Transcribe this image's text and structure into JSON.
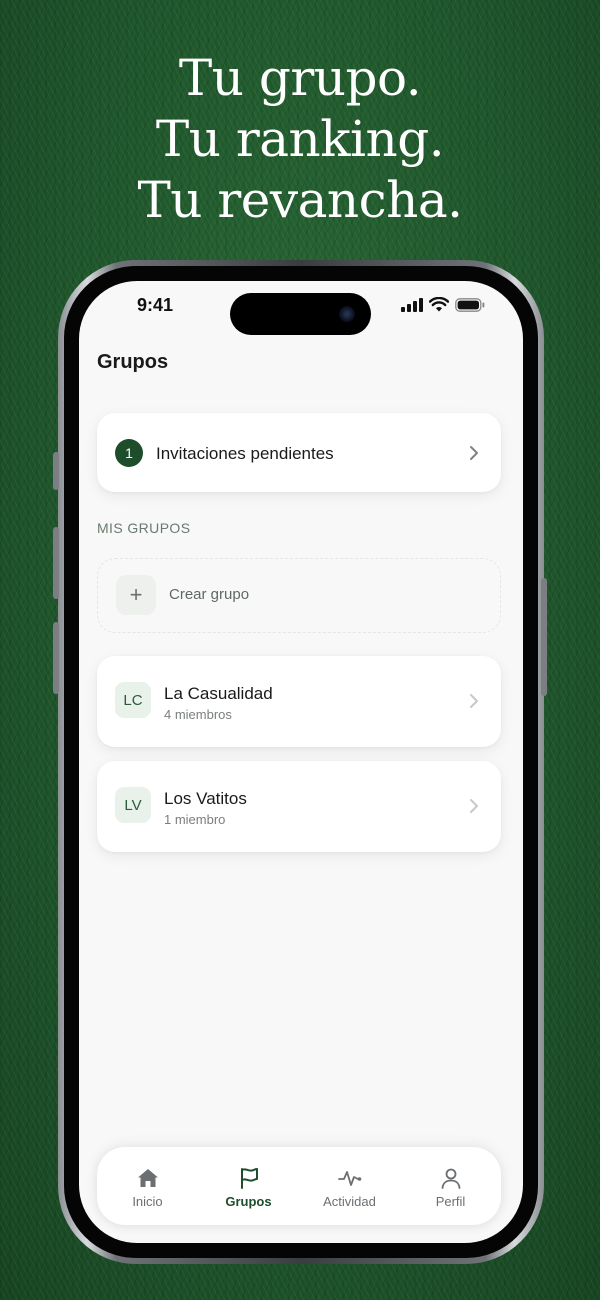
{
  "headline": {
    "line1": "Tu grupo.",
    "line2": "Tu ranking.",
    "line3": "Tu revancha."
  },
  "status_bar": {
    "time": "9:41",
    "icons": [
      "cellular-signal-icon",
      "wifi-icon",
      "battery-icon"
    ]
  },
  "page_title": "Grupos",
  "invitations": {
    "count": "1",
    "label": "Invitaciones pendientes"
  },
  "section_label": "MIS GRUPOS",
  "create_group": {
    "icon": "+",
    "label": "Crear grupo"
  },
  "groups": [
    {
      "initials": "LC",
      "name": "La Casualidad",
      "members": "4 miembros"
    },
    {
      "initials": "LV",
      "name": "Los Vatitos",
      "members": "1 miembro"
    }
  ],
  "tabs": [
    {
      "label": "Inicio",
      "icon": "home-icon",
      "active": false
    },
    {
      "label": "Grupos",
      "icon": "flag-icon",
      "active": true
    },
    {
      "label": "Actividad",
      "icon": "activity-icon",
      "active": false
    },
    {
      "label": "Perfil",
      "icon": "user-icon",
      "active": false
    }
  ],
  "colors": {
    "accent": "#1e4d2b",
    "background": "#1f5a2c",
    "screen": "#f8f8f8"
  }
}
